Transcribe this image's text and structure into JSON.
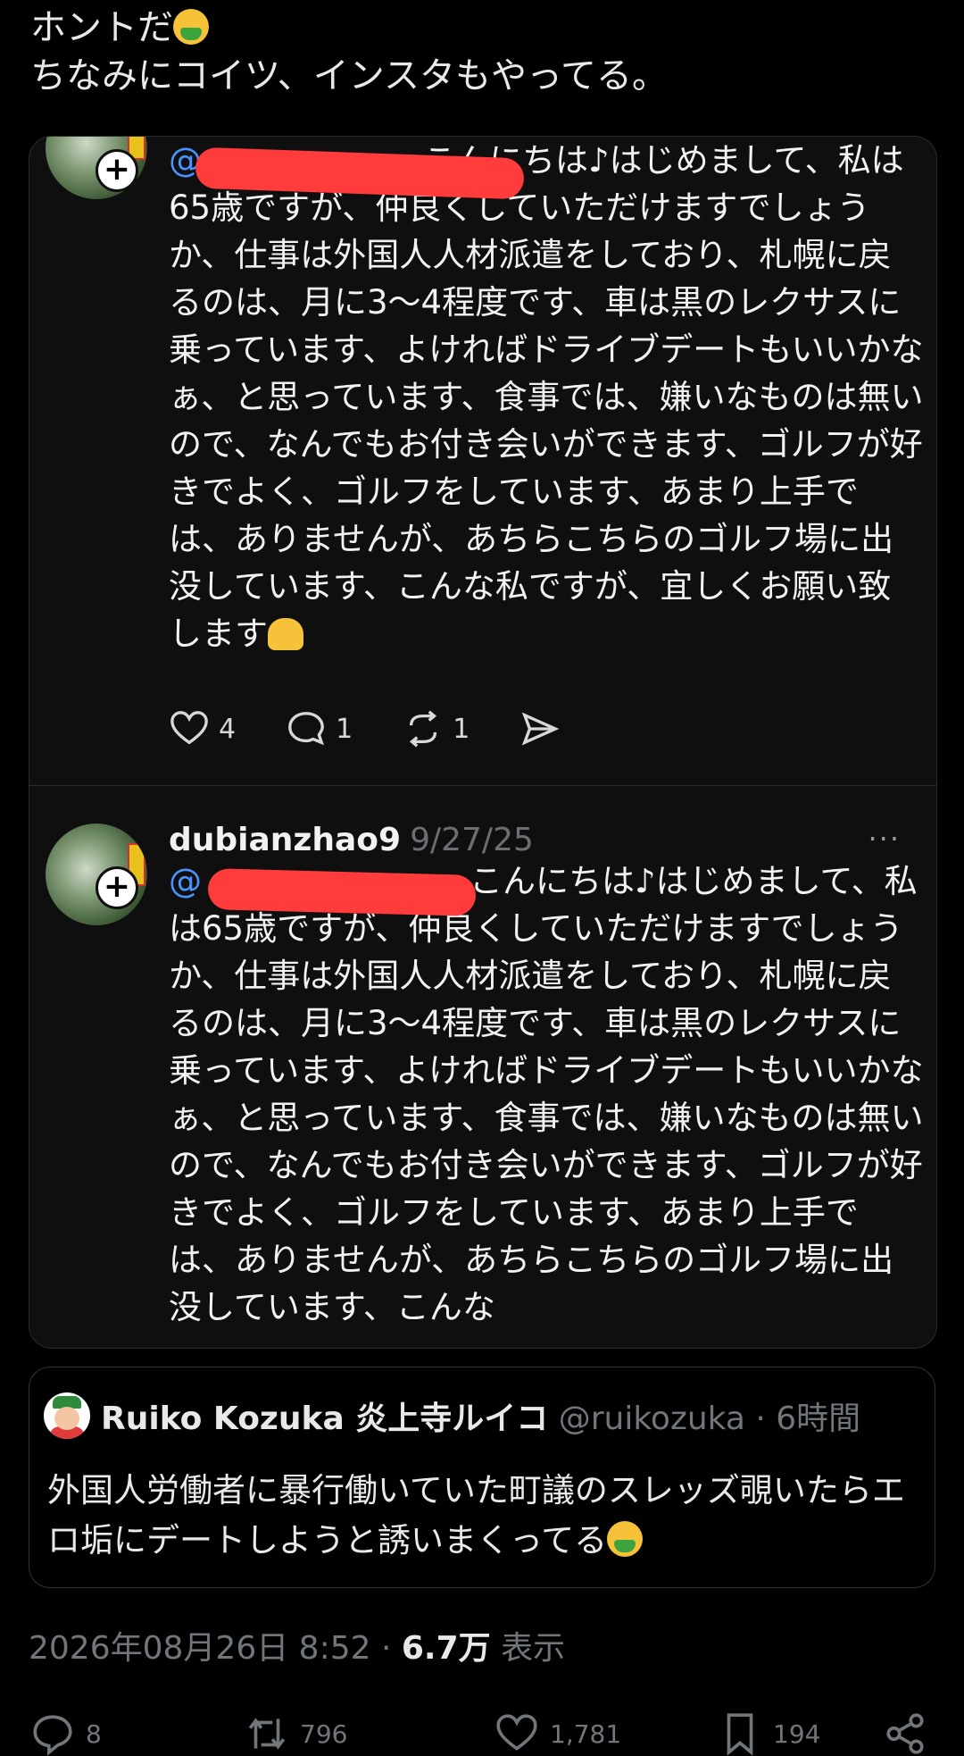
{
  "tweet": {
    "text_line1": "ホントだ",
    "text_line2": "ちなみにコイツ、インスタもやってる。"
  },
  "screenshot": {
    "post1": {
      "mention": "@",
      "text": "こんにちは♪はじめまして、私は65歳ですが、仲良くしていただけますでしょうか、仕事は外国人人材派遣をしており、札幌に戻るのは、月に3〜4程度です、車は黒のレクサスに乗っています、よければドライブデートもいいかなぁ、と思っています、食事では、嫌いなものは無いので、なんでもお付き会いができます、ゴルフが好きでよく、ゴルフをしています、あまり上手では、ありませんが、あちらこちらのゴルフ場に出没しています、こんな私ですが、宜しくお願い致します",
      "likes": "4",
      "comments": "1",
      "reposts": "1"
    },
    "post2": {
      "username": "dubianzhao9",
      "date": "9/27/25",
      "more": "···",
      "mention": "@",
      "text": "こんにちは♪はじめまして、私は65歳ですが、仲良くしていただけますでしょうか、仕事は外国人人材派遣をしており、札幌に戻るのは、月に3〜4程度です、車は黒のレクサスに乗っています、よければドライブデートもいいかなぁ、と思っています、食事では、嫌いなものは無いので、なんでもお付き会いができます、ゴルフが好きでよく、ゴルフをしています、あまり上手では、ありませんが、あちらこちらのゴルフ場に出没しています、こんな"
    }
  },
  "quote": {
    "name": "Ruiko Kozuka 炎上寺ルイコ",
    "handle": "@ruikozuka",
    "time": "· 6時間",
    "text": "外国人労働者に暴行働いていた町議のスレッズ覗いたらエロ垢にデートしようと誘いまくってる"
  },
  "timestamp": {
    "datetime": "2026年08月26日 8:52",
    "separator": " · ",
    "views": "6.7万",
    "views_label": " 表示"
  },
  "stats": {
    "replies": "8",
    "reposts": "796",
    "likes": "1,781",
    "bookmarks": "194"
  },
  "icons": [
    "heart-icon",
    "comment-icon",
    "repost-icon",
    "share-icon",
    "bookmark-icon",
    "more-icon",
    "plus-icon"
  ],
  "colors": {
    "background": "#000000",
    "mention": "#4a93ff",
    "redaction": "#ff3b3b",
    "muted": "#71767b"
  }
}
